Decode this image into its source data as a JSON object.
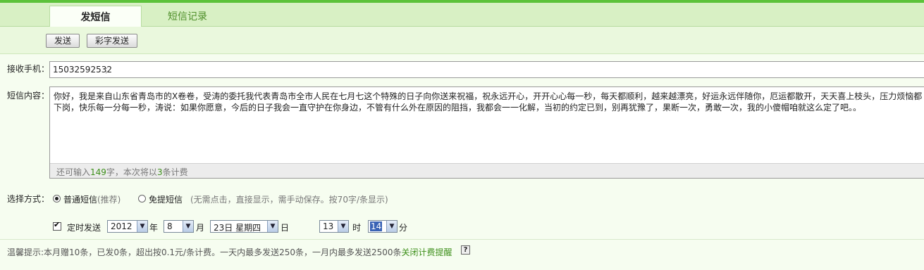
{
  "tabs": [
    {
      "label": "发短信",
      "active": true
    },
    {
      "label": "短信记录",
      "active": false
    }
  ],
  "toolbar": {
    "send_label": "发送",
    "color_send_label": "彩字发送"
  },
  "recipient": {
    "label": "接收手机：",
    "value": "15032592532",
    "separator": ";"
  },
  "message": {
    "label": "短信内容：",
    "text": "你好，我是来自山东省青岛市的X卷卷，受涛的委托我代表青岛市全市人民在七月七这个特殊的日子向你送来祝福，祝永远开心，开开心心每一秒，每天都顺利，越来越漂亮，好运永远伴随你，厄运都散开，天天喜上枝头，压力烦恼都下岗，快乐每一分每一秒，涛说：如果你愿意，今后的日子我会一直守护在你身边，不管有什么外在原因的阻挡，我都会一一化解，当初的约定已到，别再犹豫了，果断一次，勇敢一次，我的小傻帽咱就这么定了吧。。",
    "remaining_prefix": "还可输入",
    "remaining_count": "149",
    "remaining_mid": "字，本次将以",
    "sms_count": "3",
    "remaining_suffix": "条计费"
  },
  "method": {
    "label": "选择方式：",
    "option_normal": "普通短信",
    "option_normal_note": "(推荐)",
    "option_flash": "免提短信",
    "option_flash_note": "(无需点击，直接显示，需手动保存。按70字/条显示)",
    "selected": "normal"
  },
  "schedule": {
    "enabled": true,
    "label": "定时发送",
    "year": "2012",
    "year_unit": "年",
    "month": "8",
    "month_unit": "月",
    "day": "23日 星期四",
    "day_unit": "日",
    "hour": "13",
    "hour_unit": "时",
    "minute": "14",
    "minute_unit": "分"
  },
  "footer": {
    "tip": "温馨提示:本月赠10条，已发0条，超出按0.1元/条计费。一天内最多发送250条，一月内最多发送2500条",
    "link": "关闭计费提醒",
    "help": "?"
  },
  "colors": {
    "accent": "#5cc23a",
    "tab_bar": "#d8f0c4",
    "count_green": "#3d8f1a"
  }
}
